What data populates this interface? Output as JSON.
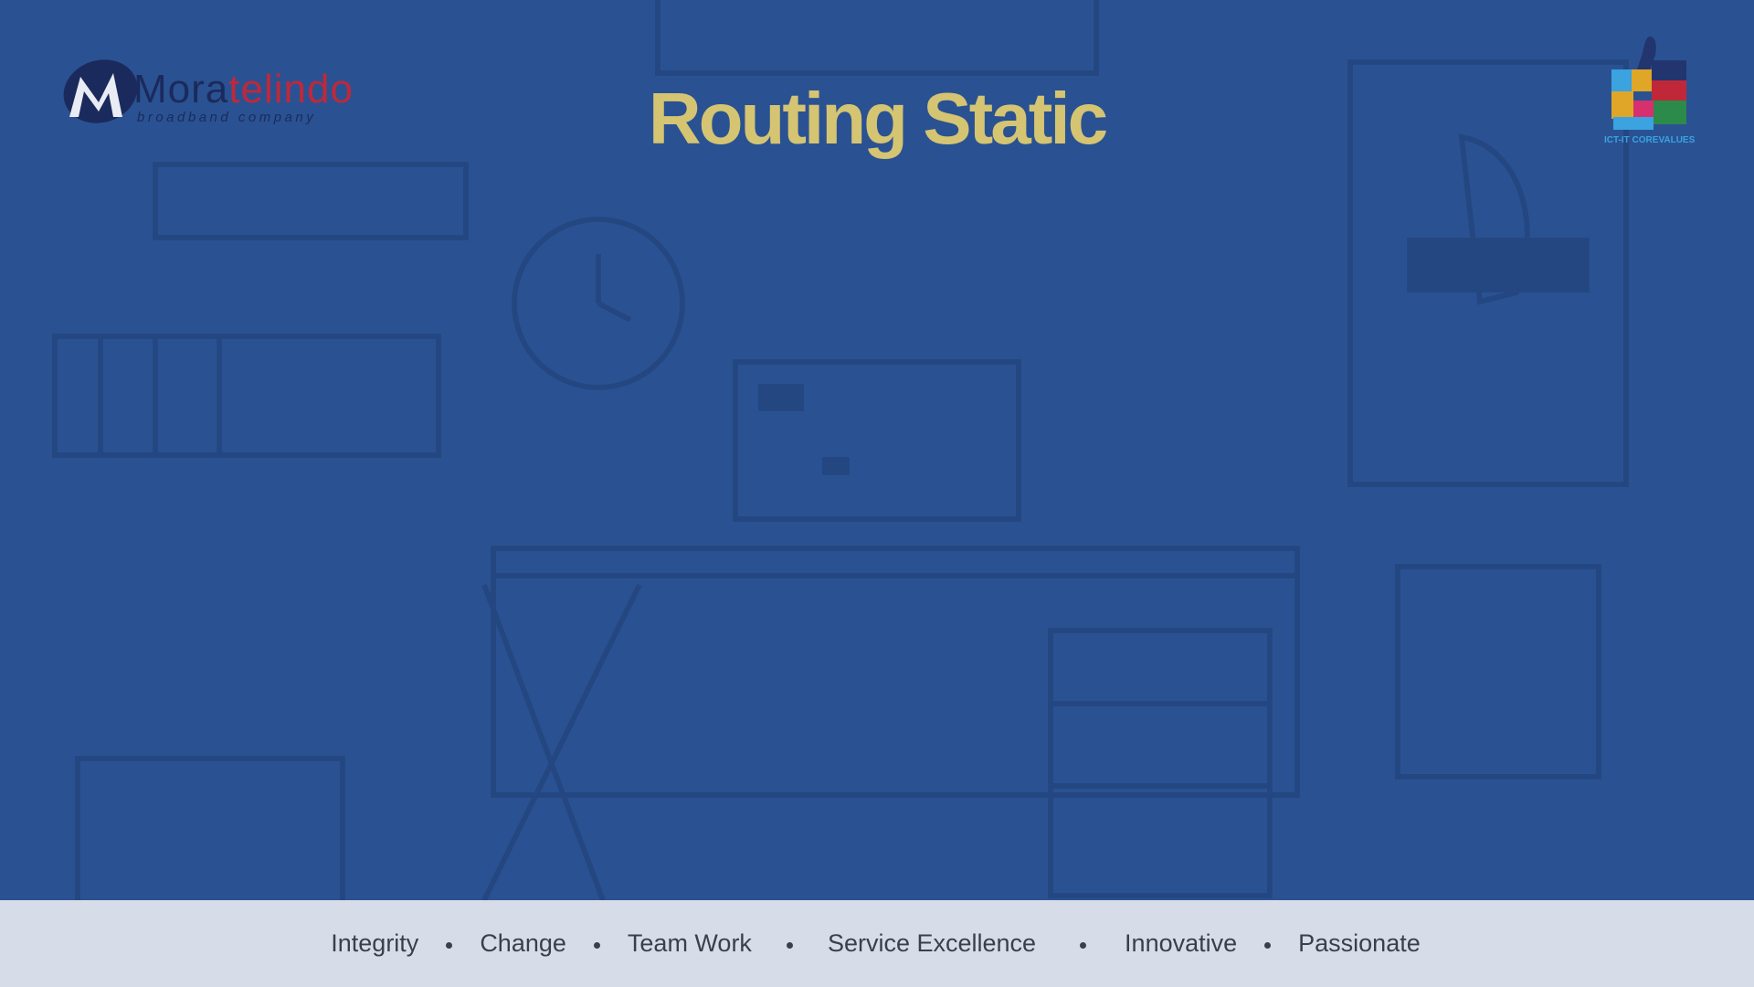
{
  "slide": {
    "title": "Routing Static",
    "background_color": "#2a5292",
    "title_color": "#d5c472"
  },
  "logo_left": {
    "name_part1": "Mora",
    "name_part2": "telindo",
    "tagline": "broadband company",
    "icon": "moratelindo-logo-icon"
  },
  "logo_right": {
    "label": "ICT-IT COREVALUES",
    "icon": "thumbs-up-puzzle-icon"
  },
  "footer": {
    "background_color": "#d6dde9",
    "values": [
      "Integrity",
      "Change",
      "Team Work",
      "Service Excellence",
      "Innovative",
      "Passionate"
    ]
  }
}
